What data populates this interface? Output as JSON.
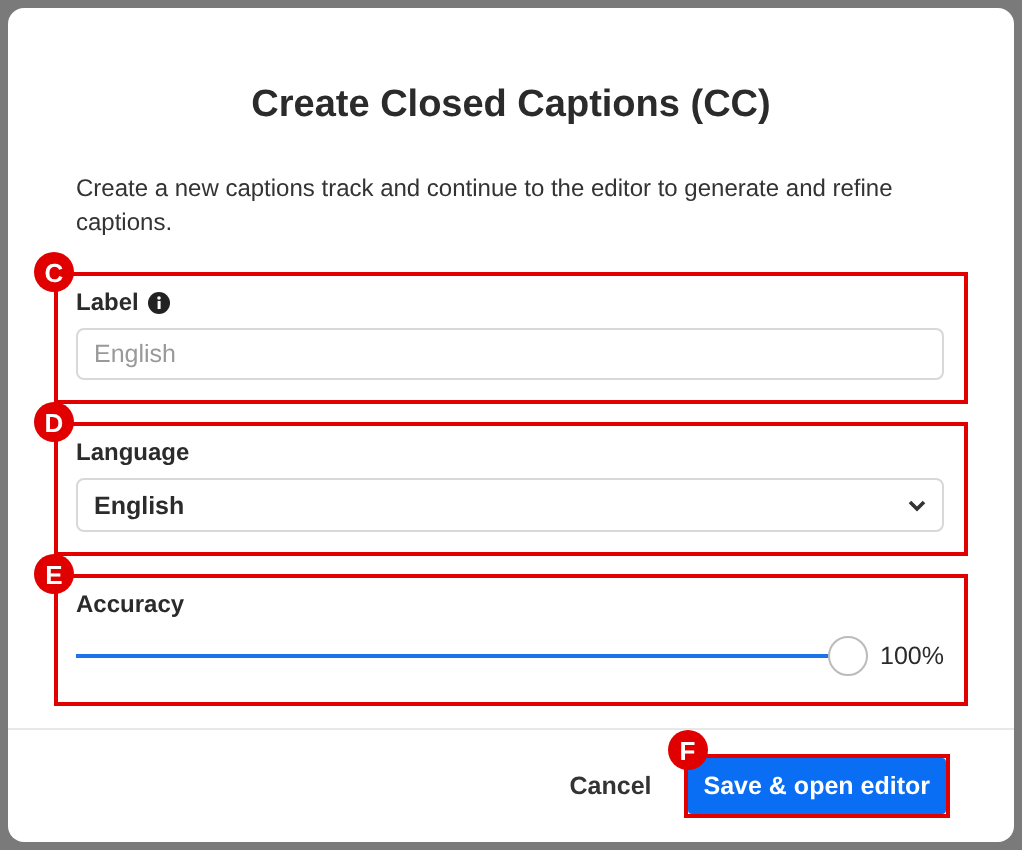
{
  "dialog": {
    "title": "Create Closed Captions (CC)",
    "description": "Create a new captions track and continue to the editor to generate and refine captions.",
    "fields": [
      {
        "kind": "text",
        "label": "Label",
        "info": true,
        "placeholder": "English",
        "callout": "C"
      },
      {
        "kind": "select",
        "label": "Language",
        "value": "English",
        "callout": "D"
      },
      {
        "kind": "slider",
        "label": "Accuracy",
        "level": 1,
        "reading": "100%",
        "callout": "E"
      }
    ],
    "buttons": [
      {
        "kind": "text",
        "label": "Cancel"
      },
      {
        "kind": "primary",
        "label": "Save & open editor",
        "callout": "F"
      }
    ]
  }
}
